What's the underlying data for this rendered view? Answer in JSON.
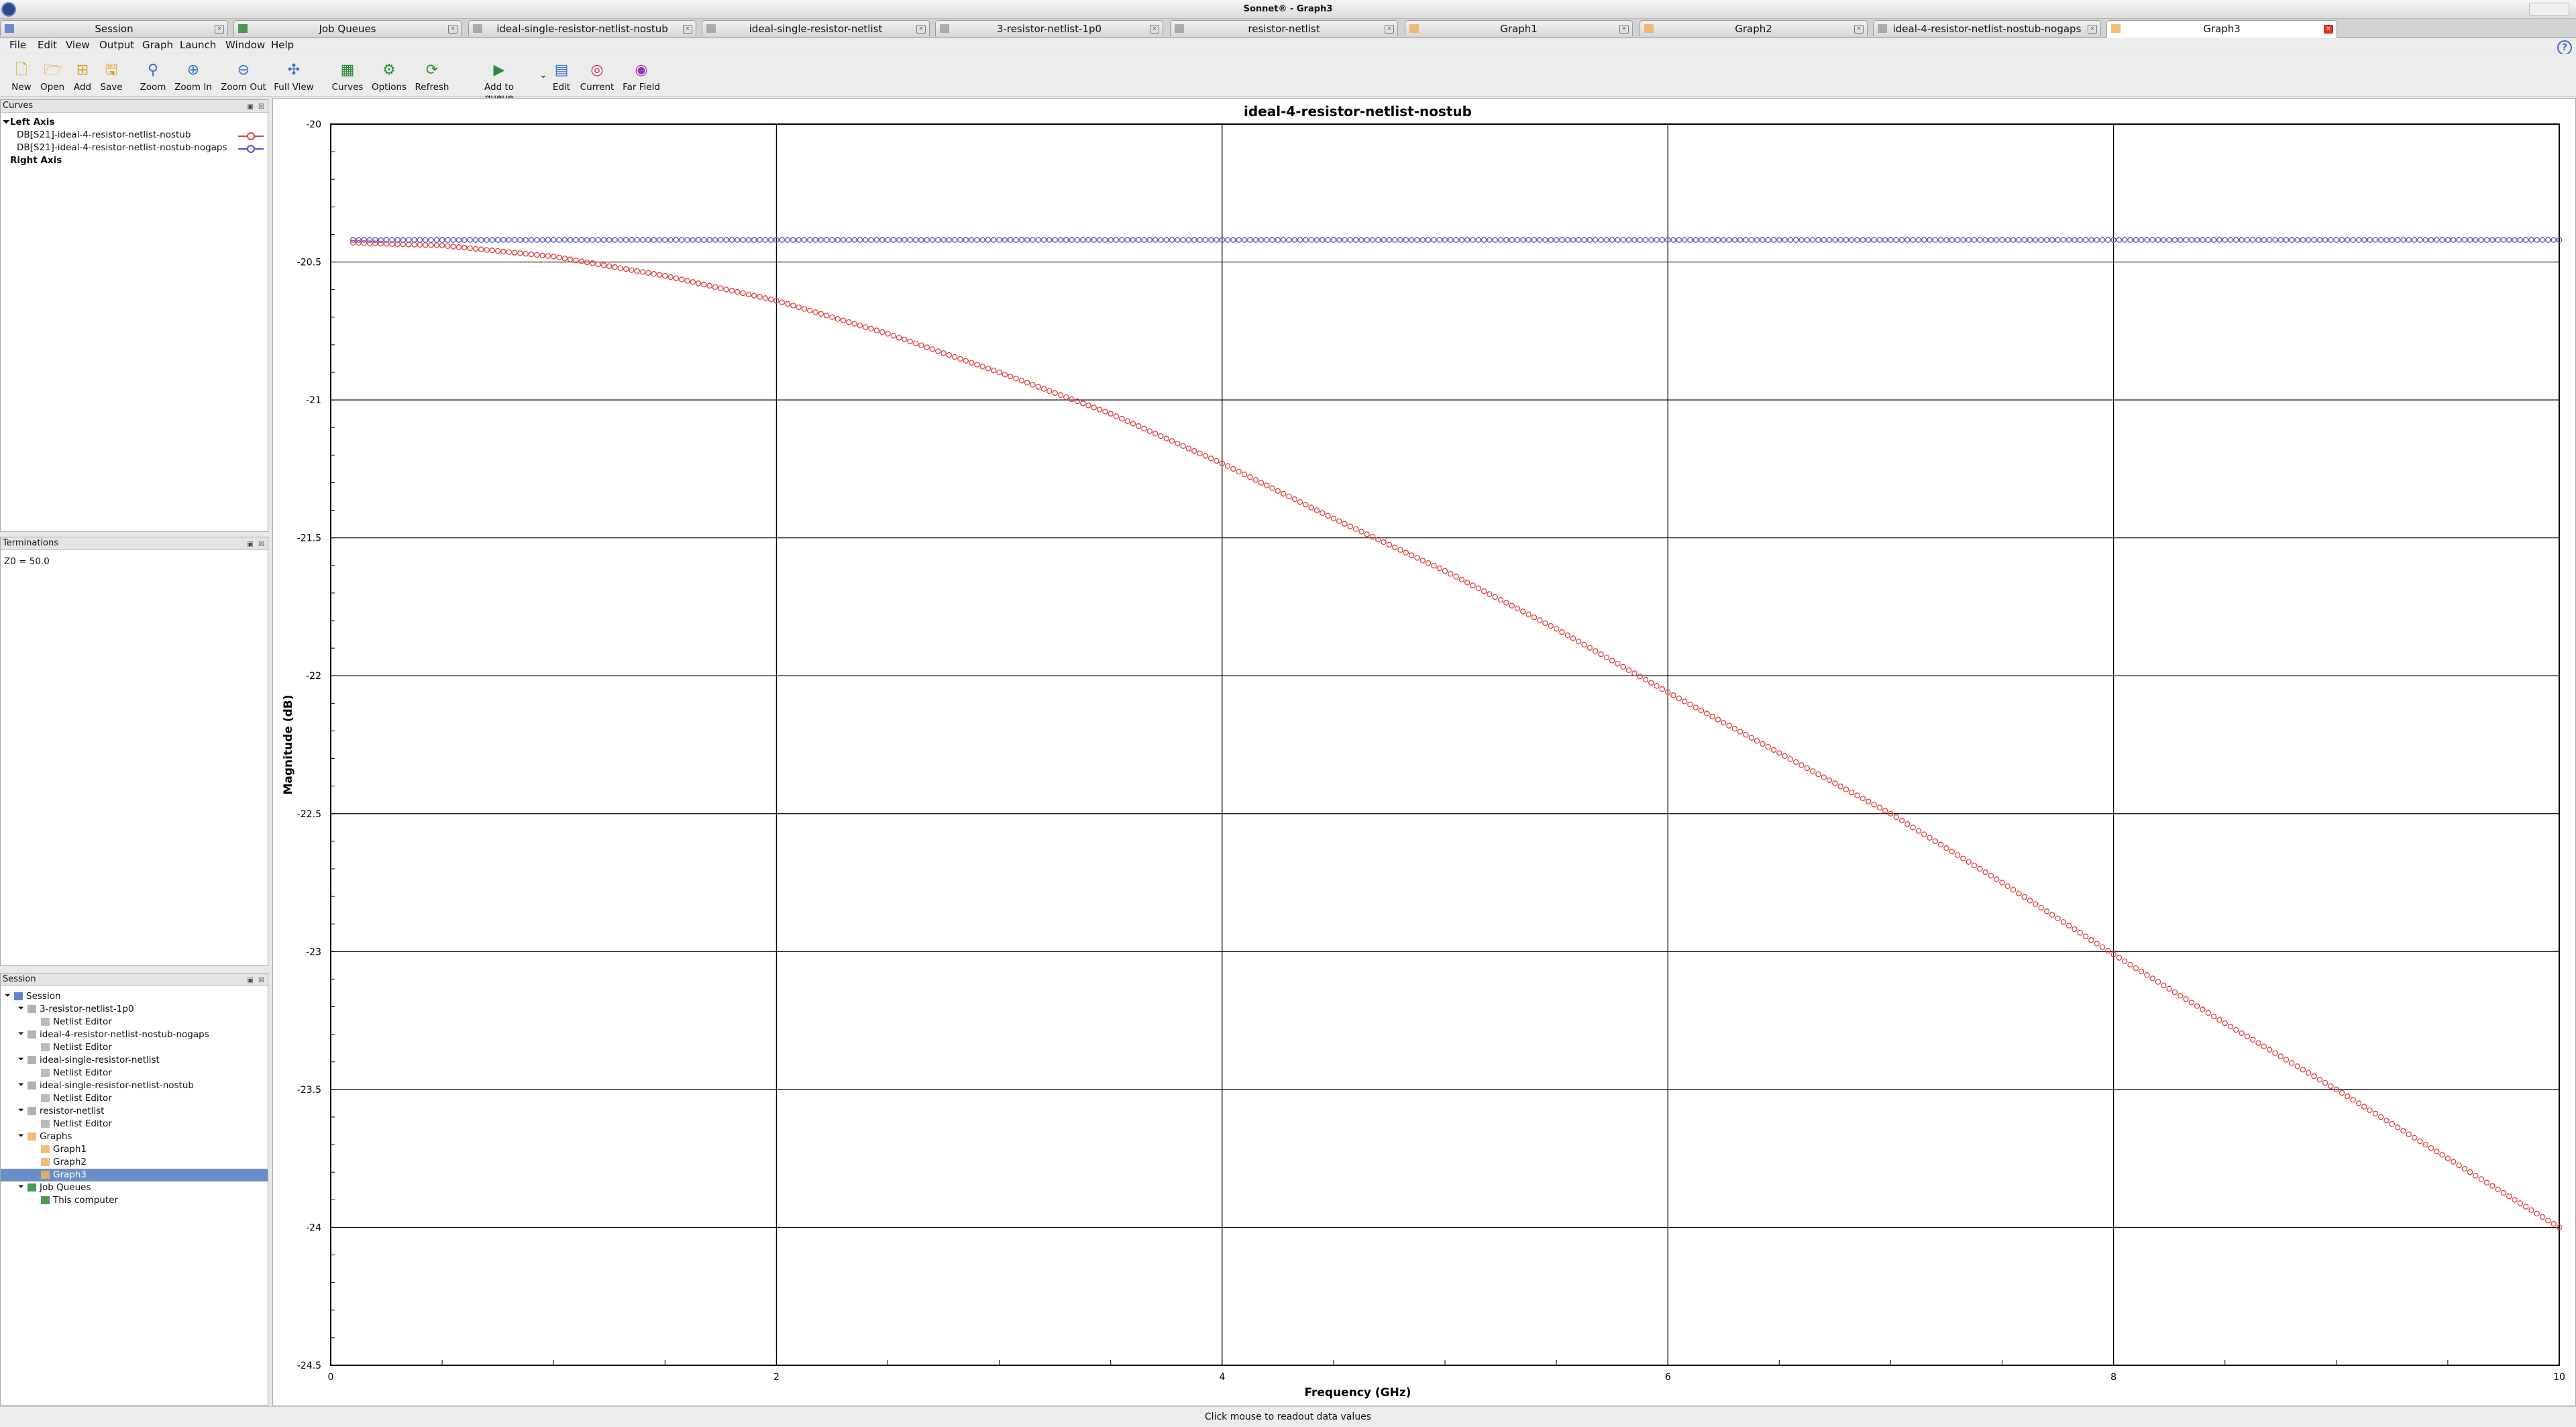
{
  "window": {
    "title": "Sonnet® - Graph3"
  },
  "tabs": [
    {
      "label": "Session",
      "icon": "session-icon"
    },
    {
      "label": "Job Queues",
      "icon": "job-queue-icon"
    },
    {
      "label": "ideal-single-resistor-netlist-nostub",
      "icon": "netlist-icon"
    },
    {
      "label": "ideal-single-resistor-netlist",
      "icon": "netlist-icon"
    },
    {
      "label": "3-resistor-netlist-1p0",
      "icon": "netlist-icon"
    },
    {
      "label": "resistor-netlist",
      "icon": "netlist-icon"
    },
    {
      "label": "Graph1",
      "icon": "graph-icon"
    },
    {
      "label": "Graph2",
      "icon": "graph-icon"
    },
    {
      "label": "ideal-4-resistor-netlist-nostub-nogaps",
      "icon": "netlist-icon"
    },
    {
      "label": "Graph3",
      "icon": "graph-icon",
      "active": true
    }
  ],
  "menu": [
    "File",
    "Edit",
    "View",
    "Output",
    "Graph",
    "Launch",
    "Window",
    "Help"
  ],
  "toolbar": [
    {
      "label": "New",
      "icon": "new-file-icon"
    },
    {
      "label": "Open",
      "icon": "open-folder-icon"
    },
    {
      "label": "Add",
      "icon": "add-icon"
    },
    {
      "label": "Save",
      "icon": "save-icon"
    },
    {
      "label": "Zoom",
      "icon": "zoom-icon"
    },
    {
      "label": "Zoom In",
      "icon": "zoom-in-icon"
    },
    {
      "label": "Zoom Out",
      "icon": "zoom-out-icon"
    },
    {
      "label": "Full View",
      "icon": "full-view-icon"
    },
    {
      "label": "Curves",
      "icon": "curves-icon"
    },
    {
      "label": "Options",
      "icon": "options-icon"
    },
    {
      "label": "Refresh",
      "icon": "refresh-icon"
    },
    {
      "label": "Add to queue",
      "icon": "add-to-queue-icon"
    },
    {
      "label": "Edit",
      "icon": "edit-icon"
    },
    {
      "label": "Current",
      "icon": "current-icon"
    },
    {
      "label": "Far Field",
      "icon": "far-field-icon"
    }
  ],
  "curves_panel": {
    "title": "Curves",
    "left_axis": "Left Axis",
    "items": [
      {
        "label": "DB[S21]-ideal-4-resistor-netlist-nostub",
        "color": "#e04040"
      },
      {
        "label": "DB[S21]-ideal-4-resistor-netlist-nostub-nogaps",
        "color": "#5050c8"
      }
    ],
    "right_axis": "Right Axis"
  },
  "terminations_panel": {
    "title": "Terminations",
    "value": "Z0 = 50.0"
  },
  "session_panel": {
    "title": "Session",
    "tree": [
      {
        "label": "Session",
        "level": 0,
        "icon": "session-icon"
      },
      {
        "label": "3-resistor-netlist-1p0",
        "level": 1,
        "icon": "netlist-icon"
      },
      {
        "label": "Netlist Editor",
        "level": 2,
        "icon": "netlist-editor-icon"
      },
      {
        "label": "ideal-4-resistor-netlist-nostub-nogaps",
        "level": 1,
        "icon": "netlist-icon"
      },
      {
        "label": "Netlist Editor",
        "level": 2,
        "icon": "netlist-editor-icon"
      },
      {
        "label": "ideal-single-resistor-netlist",
        "level": 1,
        "icon": "netlist-icon"
      },
      {
        "label": "Netlist Editor",
        "level": 2,
        "icon": "netlist-editor-icon"
      },
      {
        "label": "ideal-single-resistor-netlist-nostub",
        "level": 1,
        "icon": "netlist-icon"
      },
      {
        "label": "Netlist Editor",
        "level": 2,
        "icon": "netlist-editor-icon"
      },
      {
        "label": "resistor-netlist",
        "level": 1,
        "icon": "netlist-icon"
      },
      {
        "label": "Netlist Editor",
        "level": 2,
        "icon": "netlist-editor-icon"
      },
      {
        "label": "Graphs",
        "level": 1,
        "icon": "graph-folder-icon"
      },
      {
        "label": "Graph1",
        "level": 2,
        "icon": "graph-icon"
      },
      {
        "label": "Graph2",
        "level": 2,
        "icon": "graph-icon"
      },
      {
        "label": "Graph3",
        "level": 2,
        "icon": "graph-icon",
        "selected": true
      },
      {
        "label": "Job Queues",
        "level": 1,
        "icon": "job-queue-icon"
      },
      {
        "label": "This computer",
        "level": 2,
        "icon": "computer-check-icon"
      }
    ]
  },
  "status": "Click mouse to readout data values",
  "chart_data": {
    "type": "scatter",
    "title": "ideal-4-resistor-netlist-nostub",
    "xlabel": "Frequency (GHz)",
    "ylabel": "Magnitude (dB)",
    "xlim": [
      0,
      10
    ],
    "ylim": [
      -24.5,
      -20
    ],
    "x_ticks": [
      0,
      2,
      4,
      6,
      8,
      10
    ],
    "y_ticks": [
      -20,
      -20.5,
      -21,
      -21.5,
      -22,
      -22.5,
      -23,
      -23.5,
      -24,
      -24.5
    ],
    "grid": true,
    "series": [
      {
        "name": "DB[S21]-ideal-4-resistor-netlist-nostub",
        "color": "#e04040",
        "marker": "circle",
        "x": [
          0.1,
          0.5,
          1,
          1.5,
          2,
          2.5,
          3,
          3.5,
          4,
          4.5,
          5,
          5.5,
          6,
          6.5,
          7,
          7.5,
          8,
          8.5,
          9,
          9.5,
          10
        ],
        "y": [
          -20.43,
          -20.44,
          -20.48,
          -20.55,
          -20.64,
          -20.76,
          -20.9,
          -21.05,
          -21.23,
          -21.43,
          -21.62,
          -21.83,
          -22.06,
          -22.28,
          -22.5,
          -22.75,
          -23.01,
          -23.26,
          -23.5,
          -23.75,
          -24.0
        ]
      },
      {
        "name": "DB[S21]-ideal-4-resistor-netlist-nostub-nogaps",
        "color": "#5050c8",
        "marker": "circle",
        "x": [
          0.1,
          10
        ],
        "y": [
          -20.42,
          -20.42
        ]
      }
    ]
  }
}
